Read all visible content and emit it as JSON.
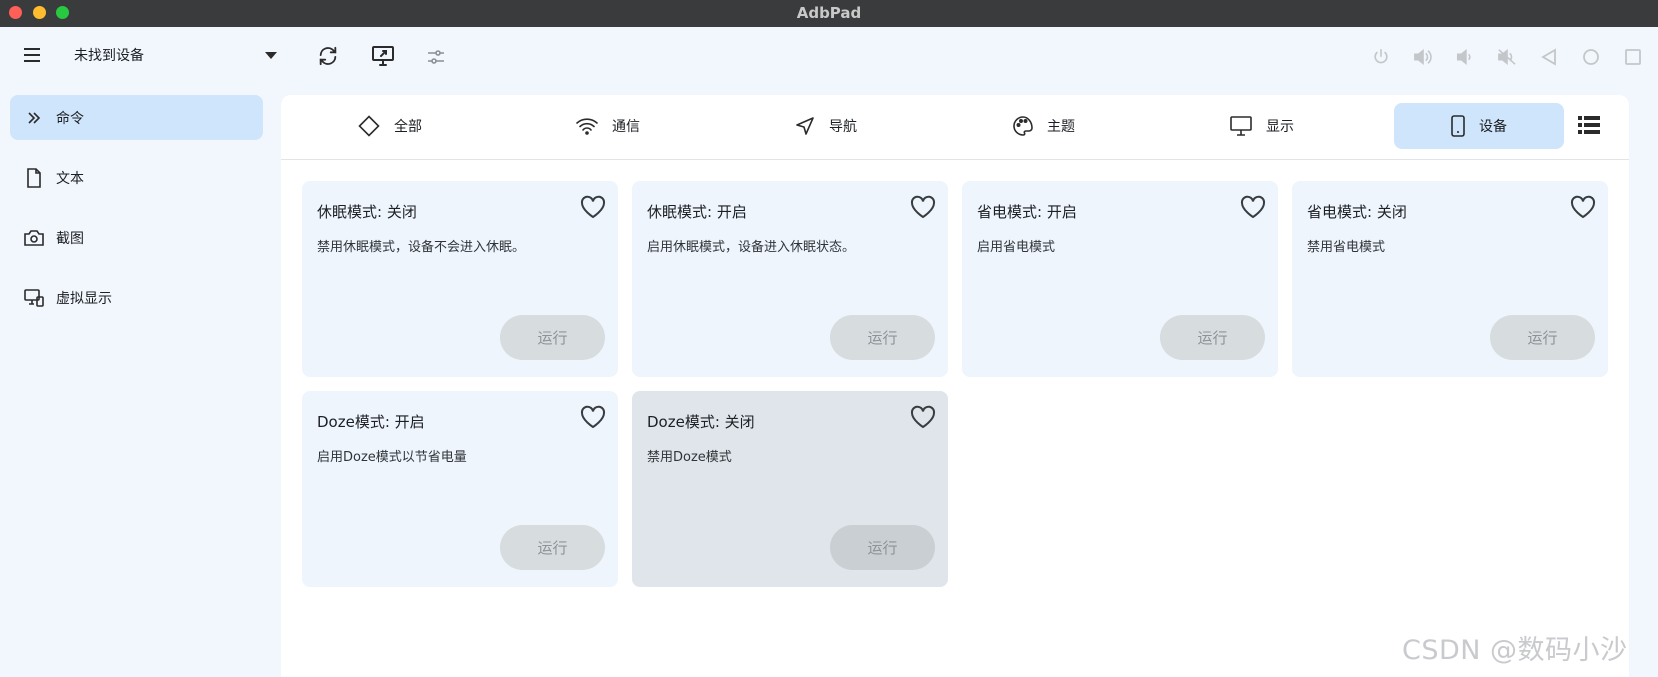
{
  "window": {
    "title": "AdbPad"
  },
  "toolbar": {
    "device": "未找到设备",
    "left_icons": [
      "menu-icon",
      "refresh-icon",
      "screen-mirror-icon",
      "settings-sliders-icon"
    ],
    "right_icons": [
      "power-icon",
      "volume-up-icon",
      "volume-down-icon",
      "mute-icon",
      "back-icon",
      "home-icon",
      "recents-icon"
    ]
  },
  "sidebar": {
    "items": [
      {
        "label": "命令",
        "icon": "chevron-double-right-icon",
        "active": true
      },
      {
        "label": "文本",
        "icon": "document-icon"
      },
      {
        "label": "截图",
        "icon": "camera-icon"
      },
      {
        "label": "虚拟显示",
        "icon": "virtual-display-icon"
      }
    ]
  },
  "tabs": [
    {
      "label": "全部",
      "icon": "diamond-icon"
    },
    {
      "label": "通信",
      "icon": "wifi-icon"
    },
    {
      "label": "导航",
      "icon": "navigation-icon"
    },
    {
      "label": "主题",
      "icon": "palette-icon"
    },
    {
      "label": "显示",
      "icon": "monitor-icon"
    },
    {
      "label": "设备",
      "icon": "phone-icon",
      "active": true
    }
  ],
  "cards": [
    {
      "title": "休眠模式: 关闭",
      "desc": "禁用休眠模式，设备不会进入休眠。",
      "run": "运行"
    },
    {
      "title": "休眠模式: 开启",
      "desc": "启用休眠模式，设备进入休眠状态。",
      "run": "运行"
    },
    {
      "title": "省电模式: 开启",
      "desc": "启用省电模式",
      "run": "运行"
    },
    {
      "title": "省电模式: 关闭",
      "desc": "禁用省电模式",
      "run": "运行"
    },
    {
      "title": "Doze模式: 开启",
      "desc": "启用Doze模式以节省电量",
      "run": "运行"
    },
    {
      "title": "Doze模式: 关闭",
      "desc": "禁用Doze模式",
      "run": "运行"
    }
  ],
  "watermark": "CSDN @数码小沙",
  "colors": {
    "accent": "#cfe5fb",
    "card": "#eef5fd",
    "background": "#f2f7fd"
  }
}
